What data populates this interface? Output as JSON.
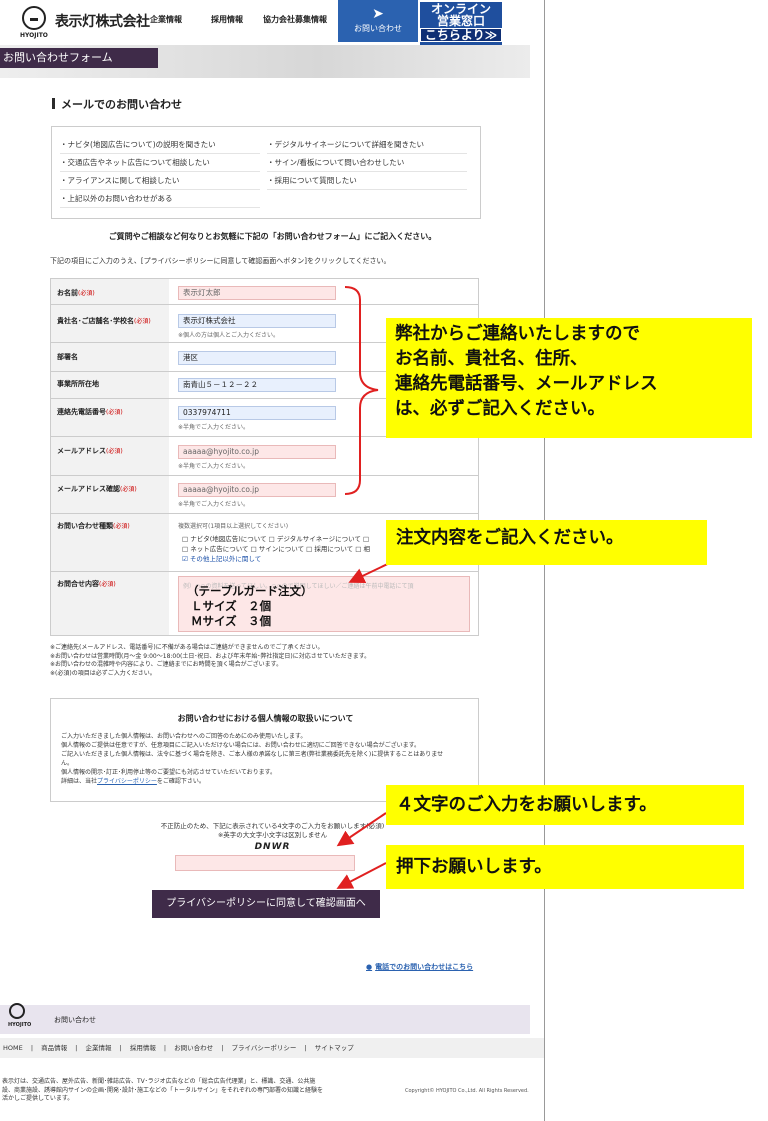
{
  "header": {
    "logo_text": "HYOJITO",
    "brand": "表示灯株式会社",
    "nav": [
      "企業情報",
      "採用情報",
      "協力会社募集情報"
    ],
    "inquiry_label": "お問い合わせ",
    "online": [
      "オンライン",
      "営業窓口",
      "こちらより≫"
    ]
  },
  "banner_title": "お問い合わせフォーム",
  "section_title": "メールでのお問い合わせ",
  "topics": [
    "・ナビタ(地図広告について)の説明を聞きたい",
    "・デジタルサイネージについて詳細を聞きたい",
    "・交通広告やネット広告について相談したい",
    "・サイン/看板について問い合わせしたい",
    "・アライアンスに関して相談したい",
    "・採用について質問したい",
    "・上記以外のお問い合わせがある"
  ],
  "lead": "ご質問やご相談など何なりとお気軽に下記の「お問い合わせフォーム」にご記入ください。",
  "description": "下記の項目にご入力のうえ、[プライバシーポリシーに同意して確認画面へボタン]をクリックしてください。",
  "required_mark": "(必須)",
  "form": {
    "name_label": "お名前",
    "name_value": "表示灯太郎",
    "company_label": "貴社名･ご店舗名･学校名",
    "company_value": "表示灯株式会社",
    "company_note": "※個人の方は個人とご入力ください。",
    "dept_label": "部署名",
    "dept_value": "港区",
    "address_label": "事業所所在地",
    "address_value": "南青山５－１２－２２",
    "phone_label": "連絡先電話番号",
    "phone_value": "0337974711",
    "halfwidth_note": "※半角でご入力ください。",
    "email_label": "メールアドレス",
    "email_value": "aaaaa@hyojito.co.jp",
    "email_confirm_label": "メールアドレス確認",
    "email_confirm_value": "aaaaa@hyojito.co.jp",
    "type_label": "お問い合わせ種類",
    "type_note": "複数選択可(1項目以上選択してください)",
    "type_line1": "□ ナビタ(地図広告)について  □ デジタルサイネージについて  □",
    "type_line2": "□ ネット広告について  □ サインについて  □ 採用について  □ 相",
    "type_checked": "☑ その他上記以外に関して",
    "content_label": "お問合せ内容",
    "content_placeholder": "例）○○の資料を送ってほしい。○○ので説明してほしい／ご連絡は午前中電話にて頂",
    "content_value": "（テーブルガード注文）\n Ｌサイズ　２個\n Ｍサイズ　３個"
  },
  "notes": [
    "※ご連絡先(メールアドレス、電話番号)に不備がある場合はご連絡ができませんのでご了承ください。",
    "※お問い合わせは営業時間(月〜金 9:00〜18:00(土日･祝日、および年末年始･弊社指定日)に対応させていただきます。",
    "※お問い合わせの混雑時や内容により、ご連絡までにお時間を頂く場合がございます。",
    "※(必須)の項目は必ずご入力ください。"
  ],
  "privacy": {
    "title": "お問い合わせにおける個人情報の取扱いについて",
    "lines": [
      "ご入力いただきました個人情報は、お問い合わせへのご回答のためにのみ使用いたします。",
      "個人情報のご提供は任意ですが、任意項目にご記入いただけない場合には、お問い合わせに適切にご回答できない場合がございます。",
      "ご記入いただきました個人情報は、法令に基づく場合を除き、ご本人様の承諾なしに第三者(弊社業務委託先を除く)に提供することはありませ",
      "ん。",
      "個人情報の開示･訂正･利用停止等のご要望にも対応させていただいております。"
    ],
    "detail_prefix": "詳細は、当社",
    "detail_link": "プライバシーポリシー",
    "detail_suffix": "をご確認下さい。"
  },
  "captcha": {
    "label_line1": "不正防止のため、下記に表示されている4文字のご入力をお願いします(必須)",
    "label_line2": "※英字の大文字小文字は区別しません",
    "code": "DNWR"
  },
  "submit_label": "プライバシーポリシーに同意して確認画面へ",
  "phone_link": "電話でのお問い合わせはこちら",
  "footer": {
    "logo_text": "HYOJITO",
    "inquiry": "お問い合わせ",
    "nav": [
      "HOME",
      "|",
      "商品情報",
      "|",
      "企業情報",
      "|",
      "採用情報",
      "|",
      "お問い合わせ",
      "|",
      "プライバシーポリシー",
      "|",
      "サイトマップ"
    ],
    "desc": [
      "表示灯は、交通広告、屋外広告、新聞･雑誌広告、TV･ラジオ広告などの「総合広告代理業」と、標識、交通、公共施",
      "設、商業施設、誘導館内サインの企画･開発･設計･施工などの「トータルサイン」をそれぞれの専門部署の知識と経験を",
      "活かしご提供しています。"
    ],
    "copyright": "Copyright© HYOJITO Co.,Ltd. All Rights Reserved."
  },
  "annotations": {
    "required_fields": "弊社からご連絡いたしますので\nお名前、貴社名、住所、\n連絡先電話番号、メールアドレス\nは、必ずご記入ください。",
    "order_content": "注文内容をご記入ください。",
    "captcha": "４文字のご入力をお願いします。",
    "press": "押下お願いします。"
  },
  "colors": {
    "accent_purple": "#3f2b49",
    "brand_blue": "#2b62b0",
    "annotation_yellow": "#ffff00",
    "arrow_red": "#e02020"
  }
}
